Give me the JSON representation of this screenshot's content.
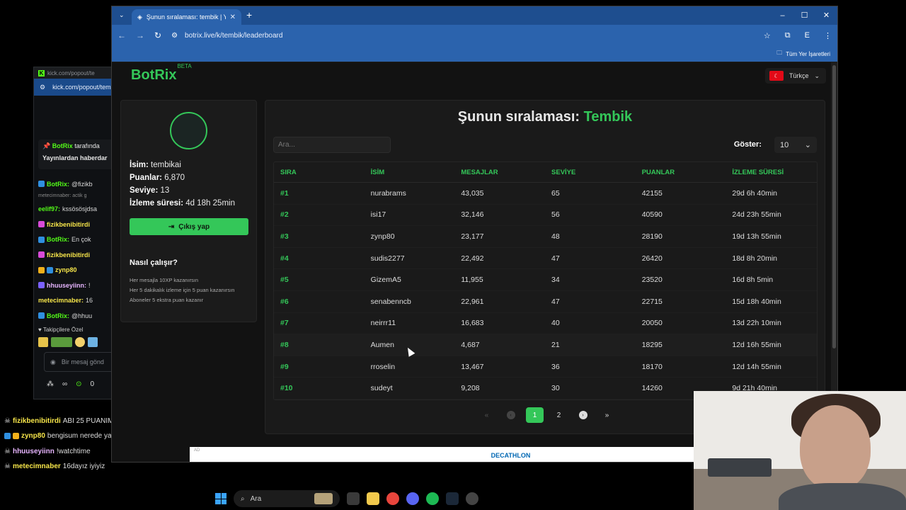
{
  "kick": {
    "title_url": "kick.com/popout/te",
    "url": "kick.com/popout/tem",
    "pinned_name": "BotRix",
    "pinned_suffix": "tarafında",
    "pinned_text": "Yayınlardan haberdar",
    "chat": [
      {
        "name": "BotRix:",
        "text": "@fizikb",
        "color": "g"
      },
      {
        "name": "metecimnaber: actik g",
        "text": "",
        "color": "dim"
      },
      {
        "name": "eelif97:",
        "text": "kssösösjdsa",
        "color": "g"
      },
      {
        "name": "fizikbenibitirdi",
        "text": "",
        "color": "y"
      },
      {
        "name": "BotRix:",
        "text": "En çok",
        "color": "g"
      },
      {
        "name": "fizikbenibitirdi",
        "text": "",
        "color": "y"
      },
      {
        "name": "zynp80",
        "text": "",
        "color": "y"
      },
      {
        "name": "hhuuseyiinn:",
        "text": "!",
        "color": "p"
      },
      {
        "name": "metecimnaber:",
        "text": "16",
        "color": "y"
      },
      {
        "name": "BotRix:",
        "text": "@hhuu",
        "color": "g"
      }
    ],
    "followers_label": "Takipçilere Özel",
    "input_placeholder": "Bir mesaj gönd",
    "infinity": "∞",
    "count": "0"
  },
  "bottom_chat": [
    {
      "name": "fizikbenibitirdi",
      "text": "ABI 25 PUANIM KALDI",
      "color": "y"
    },
    {
      "name": "zynp80",
      "text": "bengisum nerede ya",
      "color": "y"
    },
    {
      "name": "hhuuseyiinn",
      "text": "!watchtime",
      "color": "p"
    },
    {
      "name": "metecimnaber",
      "text": "16dayız iyiyiz",
      "color": "y"
    }
  ],
  "browser": {
    "tab_title": "Şunun sıralaması: tembik | Yayı",
    "url": "botrix.live/k/tembik/leaderboard",
    "bookmarks_label": "Tüm Yer İşaretleri",
    "profile_initial": "E"
  },
  "site": {
    "logo": "BotRix",
    "logo_badge": "BETA",
    "language": "Türkçe",
    "profile": {
      "name_label": "İsim:",
      "name": "tembikai",
      "points_label": "Puanlar:",
      "points": "6,870",
      "level_label": "Seviye:",
      "level": "13",
      "watch_label": "İzleme süresi:",
      "watch": "4d 18h 25min",
      "logout": "Çıkış yap"
    },
    "how": {
      "title": "Nasıl çalışır?",
      "lines": [
        "Her mesajla 10XP kazanırsın",
        "Her 5 dakikalık izleme için 5 puan kazanırsın",
        "Aboneler 5 ekstra puan kazanır"
      ]
    },
    "board": {
      "title_prefix": "Şunun sıralaması:",
      "title_channel": "Tembik",
      "search_placeholder": "Ara...",
      "show_label": "Göster:",
      "show_value": "10",
      "columns": [
        "SIRA",
        "İSİM",
        "MESAJLAR",
        "SEVİYE",
        "PUANLAR",
        "İZLEME SÜRESİ"
      ],
      "rows": [
        [
          "#1",
          "nurabrams",
          "43,035",
          "65",
          "42155",
          "29d 6h 40min"
        ],
        [
          "#2",
          "isi17",
          "32,146",
          "56",
          "40590",
          "24d 23h 55min"
        ],
        [
          "#3",
          "zynp80",
          "23,177",
          "48",
          "28190",
          "19d 13h 55min"
        ],
        [
          "#4",
          "sudis2277",
          "22,492",
          "47",
          "26420",
          "18d 8h 20min"
        ],
        [
          "#5",
          "GizemA5",
          "11,955",
          "34",
          "23520",
          "16d 8h 5min"
        ],
        [
          "#6",
          "senabenncb",
          "22,961",
          "47",
          "22715",
          "15d 18h 40min"
        ],
        [
          "#7",
          "neirrr11",
          "16,683",
          "40",
          "20050",
          "13d 22h 10min"
        ],
        [
          "#8",
          "Aumen",
          "4,687",
          "21",
          "18295",
          "12d 16h 55min"
        ],
        [
          "#9",
          "rroselin",
          "13,467",
          "36",
          "18170",
          "12d 14h 55min"
        ],
        [
          "#10",
          "sudeyt",
          "9,208",
          "30",
          "14260",
          "9d 21h 40min"
        ]
      ],
      "pages": [
        "1",
        "2"
      ],
      "current_page": "1"
    },
    "ad": {
      "label": "AD",
      "brand": "DECATHLON"
    }
  },
  "taskbar": {
    "search_label": "Ara"
  }
}
